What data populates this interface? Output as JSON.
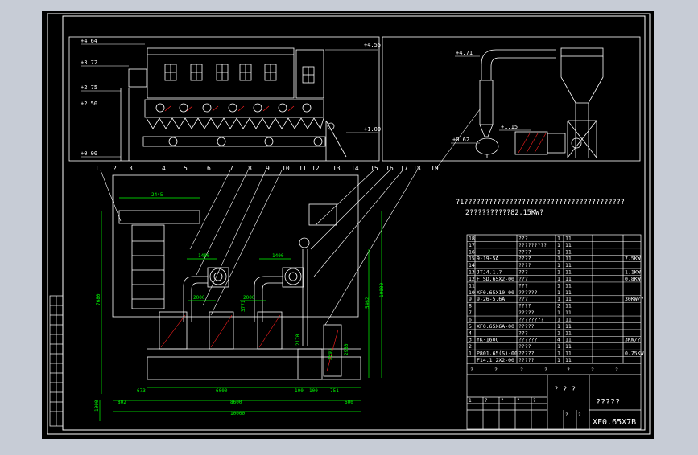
{
  "colors": {
    "background": "#c7ccd6",
    "sheet": "#000000",
    "line": "#ffffff",
    "dimension": "#00ff00",
    "text": "#ffffff",
    "hatch": "#ff2020"
  },
  "elevations": [
    "+4.64",
    "+3.72",
    "+2.75",
    "+2.50",
    "+0.00",
    "+4.55",
    "+1.00",
    "+4.71",
    "+1.15",
    "+0.62"
  ],
  "callouts": [
    "1",
    "2",
    "3",
    "4",
    "5",
    "6",
    "7",
    "8",
    "9",
    "10",
    "11",
    "12",
    "13",
    "14",
    "15",
    "16",
    "17",
    "18",
    "19"
  ],
  "dimensions": [
    "2445",
    "1400",
    "1400",
    "2000",
    "2000",
    "3771",
    "7680",
    "5462",
    "10000",
    "2170",
    "2691",
    "2980",
    "673",
    "6000",
    "100",
    "100",
    "751",
    "802",
    "8600",
    "600",
    "10000",
    "1000"
  ],
  "notes": {
    "line1": "?1???????????????????????????????????????",
    "line2": "2??????????82.15KW?"
  },
  "bom": {
    "rows": [
      {
        "no": "18",
        "code": "",
        "name": "???",
        "qty": "1",
        "unit": "11",
        "note": ""
      },
      {
        "no": "17",
        "code": "",
        "name": "?????????",
        "qty": "1",
        "unit": "11",
        "note": ""
      },
      {
        "no": "16",
        "code": "",
        "name": "????",
        "qty": "1",
        "unit": "11",
        "note": ""
      },
      {
        "no": "15",
        "code": "9-19-5A",
        "name": "????",
        "qty": "1",
        "unit": "11",
        "note": "7.5KW"
      },
      {
        "no": "14",
        "code": "",
        "name": "????",
        "qty": "1",
        "unit": "11",
        "note": ""
      },
      {
        "no": "13",
        "code": "JTJ4.1.?",
        "name": "???",
        "qty": "1",
        "unit": "11",
        "note": "1.1KW"
      },
      {
        "no": "12",
        "code": "F SD.65X2-00",
        "name": "???",
        "qty": "1",
        "unit": "11",
        "note": "0.8KW"
      },
      {
        "no": "11",
        "code": "",
        "name": "???",
        "qty": "1",
        "unit": "11",
        "note": ""
      },
      {
        "no": "10",
        "code": "XF0.65X10-00",
        "name": "??????",
        "qty": "1",
        "unit": "11",
        "note": ""
      },
      {
        "no": "9",
        "code": "9-26-5.6A",
        "name": "???",
        "qty": "1",
        "unit": "11",
        "note": "30KW/?"
      },
      {
        "no": "8",
        "code": "",
        "name": "????",
        "qty": "2",
        "unit": "11",
        "note": ""
      },
      {
        "no": "7",
        "code": "",
        "name": "?????",
        "qty": "1",
        "unit": "11",
        "note": ""
      },
      {
        "no": "6",
        "code": "",
        "name": "????????",
        "qty": "1",
        "unit": "11",
        "note": ""
      },
      {
        "no": "5",
        "code": "XF0.65X6A-00",
        "name": "?????",
        "qty": "1",
        "unit": "11",
        "note": ""
      },
      {
        "no": "4",
        "code": "",
        "name": "???",
        "qty": "1",
        "unit": "11",
        "note": ""
      },
      {
        "no": "3",
        "code": "YK-160C",
        "name": "??????",
        "qty": "4",
        "unit": "11",
        "note": "3KW/?"
      },
      {
        "no": "2",
        "code": "",
        "name": "????",
        "qty": "1",
        "unit": "11",
        "note": ""
      },
      {
        "no": "1",
        "code": "P801.65(S)-00",
        "name": "?????",
        "qty": "1",
        "unit": "11",
        "note": "0.75KW"
      },
      {
        "no": "",
        "code": "F14.1.2X2-00",
        "name": "?????",
        "qty": "1",
        "unit": "11",
        "note": ""
      }
    ],
    "footer": [
      "?",
      "?",
      "?",
      "?",
      "?",
      "?",
      "?"
    ]
  },
  "title_block": {
    "project": "? ? ?",
    "name": "?????",
    "drawing_no": "XF0.65X7B",
    "small_cells": [
      "1:",
      "?",
      "?",
      "?",
      "?",
      "?",
      "?"
    ]
  }
}
